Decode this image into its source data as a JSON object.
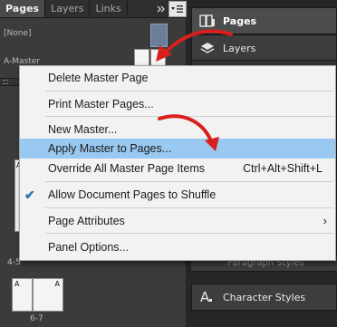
{
  "left_panel": {
    "tabs": [
      {
        "label": "Pages",
        "active": true
      },
      {
        "label": "Layers",
        "active": false
      },
      {
        "label": "Links",
        "active": false
      }
    ],
    "collapse_icon": "double-chevron-right-icon",
    "panel_menu_icon": "panel-menu-icon",
    "masters": {
      "none_label": "[None]",
      "a_master_label": "A-Master"
    },
    "page_prefix": "A",
    "spreads": [
      {
        "label": "4-5"
      },
      {
        "label": "6-7"
      }
    ]
  },
  "right_panels": {
    "pages": {
      "label": "Pages",
      "icon": "pages-icon"
    },
    "layers": {
      "label": "Layers",
      "icon": "layers-icon"
    },
    "paragraph_styles": {
      "label": "Paragraph Styles",
      "icon": "paragraph-styles-icon"
    },
    "character_styles": {
      "label": "Character Styles",
      "icon": "character-styles-icon"
    }
  },
  "context_menu": {
    "items": {
      "delete_master": {
        "label": "Delete Master Page"
      },
      "print_master": {
        "label": "Print Master Pages..."
      },
      "new_master": {
        "label": "New Master..."
      },
      "apply_master": {
        "label": "Apply Master to Pages...",
        "highlighted": true
      },
      "override_all": {
        "label": "Override All Master Page Items",
        "shortcut": "Ctrl+Alt+Shift+L"
      },
      "allow_shuffle": {
        "label": "Allow Document Pages to Shuffle",
        "checked": true
      },
      "page_attributes": {
        "label": "Page Attributes",
        "submenu": true
      },
      "panel_options": {
        "label": "Panel Options..."
      }
    }
  },
  "colors": {
    "highlight": "#99c8f0",
    "annotation_arrow": "#d9201c",
    "checkmark": "#2a6fb8"
  }
}
